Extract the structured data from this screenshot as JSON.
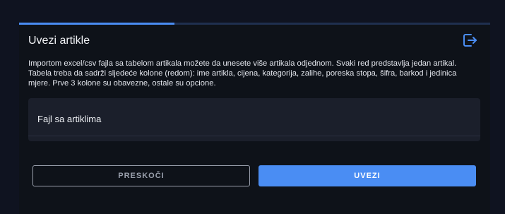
{
  "dialog": {
    "title": "Uvezi artikle",
    "progress": 0.33,
    "description": "Importom excel/csv fajla sa tabelom artikala možete da unesete više artikala odjednom. Svaki red predstavlja jedan artikal. Tabela treba da sadrži sljedeće kolone (redom): ime artikla, cijena, kategorija, zalihe, poreska stopa, šifra, barkod i jedinica mjere. Prve 3 kolone su obavezne, ostale su opcione.",
    "exit_icon": "exit-icon",
    "file_field": {
      "label": "Fajl sa artiklima"
    },
    "buttons": {
      "skip_label": "PRESKOČI",
      "import_label": "UVEZI"
    }
  },
  "colors": {
    "background": "#0e1219",
    "accent": "#4a8df3",
    "panel": "#1b1f2b",
    "text": "#f1f3f6",
    "muted": "#9aa0ad"
  }
}
